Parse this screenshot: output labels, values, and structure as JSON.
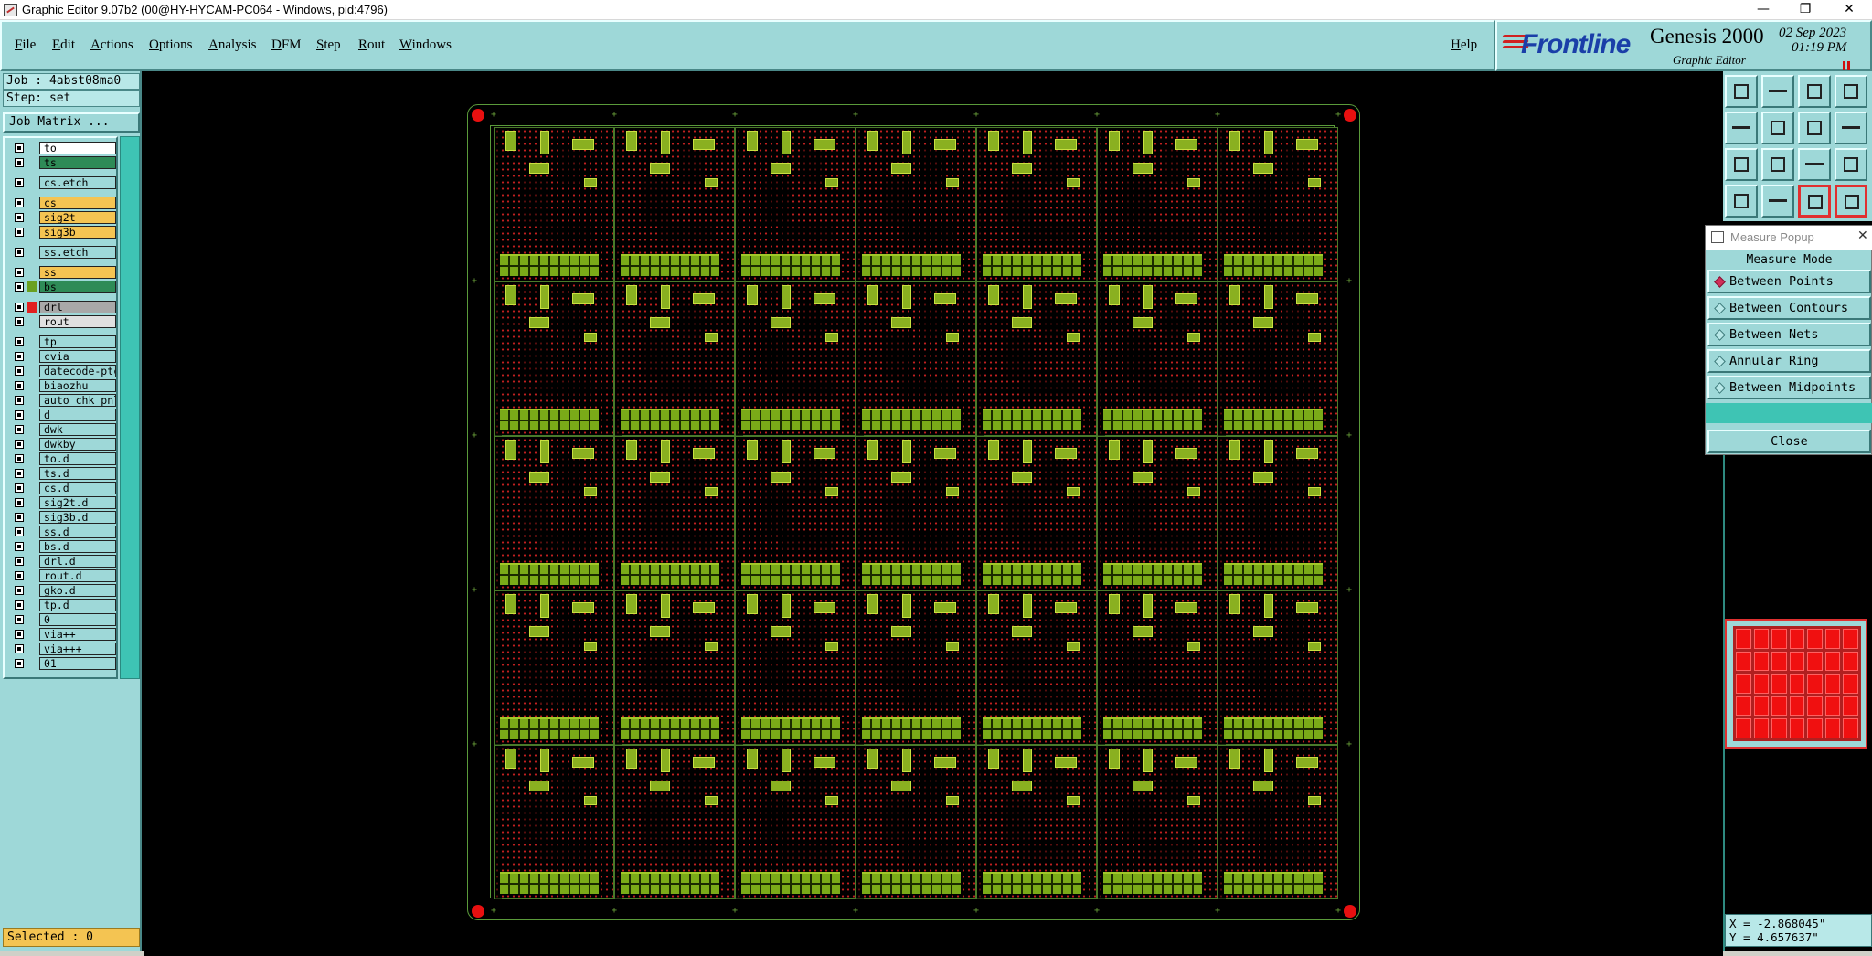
{
  "window": {
    "title": "Graphic Editor 9.07b2 (00@HY-HYCAM-PC064 - Windows, pid:4796)",
    "minimize": "—",
    "restore": "❐",
    "close": "✕"
  },
  "menubar": {
    "items": [
      "File",
      "Edit",
      "Actions",
      "Options",
      "Analysis",
      "DFM",
      "Step",
      "Rout",
      "Windows"
    ],
    "help": "Help"
  },
  "brand": {
    "logo": "Frontline",
    "product": "Genesis 2000",
    "subtitle": "Graphic Editor",
    "date": "02 Sep 2023",
    "time": "01:19 PM"
  },
  "job": {
    "job_label": "Job : 4abst08ma0",
    "step_label": "Step: set",
    "job_matrix_button": "Job Matrix ..."
  },
  "layers": [
    {
      "name": "to",
      "color": "#ffffff",
      "swatch": "",
      "gap": false
    },
    {
      "name": "ts",
      "color": "#2e8b57",
      "swatch": "",
      "gap": false
    },
    {
      "name": "cs.etch",
      "color": "#9ed8d8",
      "swatch": "",
      "gap": true
    },
    {
      "name": "cs",
      "color": "#f4c452",
      "swatch": "",
      "gap": true
    },
    {
      "name": "sig2t",
      "color": "#f4c452",
      "swatch": "",
      "gap": false
    },
    {
      "name": "sig3b",
      "color": "#f4c452",
      "swatch": "",
      "gap": false
    },
    {
      "name": "ss.etch",
      "color": "#9ed8d8",
      "swatch": "",
      "gap": true
    },
    {
      "name": "ss",
      "color": "#f4c452",
      "swatch": "",
      "gap": true
    },
    {
      "name": "bs",
      "color": "#2e8b57",
      "swatch": "#6aa020",
      "gap": false
    },
    {
      "name": "drl",
      "color": "#a8a8a8",
      "swatch": "#e02020",
      "gap": true
    },
    {
      "name": "rout",
      "color": "#e0e0e0",
      "swatch": "",
      "gap": false
    },
    {
      "name": "tp",
      "color": "#9ed8d8",
      "swatch": "",
      "gap": true
    },
    {
      "name": "cvia",
      "color": "#9ed8d8",
      "swatch": "",
      "gap": false
    },
    {
      "name": "datecode-ptc",
      "color": "#9ed8d8",
      "swatch": "",
      "gap": false
    },
    {
      "name": "biaozhu",
      "color": "#9ed8d8",
      "swatch": "",
      "gap": false
    },
    {
      "name": "auto_chk_pnl",
      "color": "#9ed8d8",
      "swatch": "",
      "gap": false
    },
    {
      "name": "d",
      "color": "#9ed8d8",
      "swatch": "",
      "gap": false
    },
    {
      "name": "dwk",
      "color": "#9ed8d8",
      "swatch": "",
      "gap": false
    },
    {
      "name": "dwkby",
      "color": "#9ed8d8",
      "swatch": "",
      "gap": false
    },
    {
      "name": "to.d",
      "color": "#9ed8d8",
      "swatch": "",
      "gap": false
    },
    {
      "name": "ts.d",
      "color": "#9ed8d8",
      "swatch": "",
      "gap": false
    },
    {
      "name": "cs.d",
      "color": "#9ed8d8",
      "swatch": "",
      "gap": false
    },
    {
      "name": "sig2t.d",
      "color": "#9ed8d8",
      "swatch": "",
      "gap": false
    },
    {
      "name": "sig3b.d",
      "color": "#9ed8d8",
      "swatch": "",
      "gap": false
    },
    {
      "name": "ss.d",
      "color": "#9ed8d8",
      "swatch": "",
      "gap": false
    },
    {
      "name": "bs.d",
      "color": "#9ed8d8",
      "swatch": "",
      "gap": false
    },
    {
      "name": "drl.d",
      "color": "#9ed8d8",
      "swatch": "",
      "gap": false
    },
    {
      "name": "rout.d",
      "color": "#9ed8d8",
      "swatch": "",
      "gap": false
    },
    {
      "name": "gko.d",
      "color": "#9ed8d8",
      "swatch": "",
      "gap": false
    },
    {
      "name": "tp.d",
      "color": "#9ed8d8",
      "swatch": "",
      "gap": false
    },
    {
      "name": "0",
      "color": "#9ed8d8",
      "swatch": "",
      "gap": false
    },
    {
      "name": "via++",
      "color": "#9ed8d8",
      "swatch": "",
      "gap": false
    },
    {
      "name": "via+++",
      "color": "#9ed8d8",
      "swatch": "",
      "gap": false
    },
    {
      "name": "01",
      "color": "#9ed8d8",
      "swatch": "",
      "gap": false
    }
  ],
  "status": {
    "selected": "Selected : 0"
  },
  "toolbar": {
    "icons": [
      "top-view-icon",
      "bottom-view-icon",
      "home-icon",
      "split-window-icon",
      "pan-left-icon",
      "pan-right-icon",
      "zoom-box-icon",
      "redraw-icon",
      "zoom-fit-icon",
      "zoom-center-icon",
      "scale-one-to-two-icon",
      "help-question-icon",
      "measure-icon",
      "snap-icon",
      "layer-red-icon",
      "layer-red-2-icon"
    ]
  },
  "measure_popup": {
    "title": "Measure Popup",
    "close_x": "✕",
    "mode_header": "Measure Mode",
    "options": [
      "Between Points",
      "Between Contours",
      "Between Nets",
      "Annular Ring",
      "Between Midpoints"
    ],
    "selected_option": "Between Points",
    "close_button": "Close"
  },
  "coordinates": {
    "x": "X = -2.868045\"",
    "y": "Y = 4.657637\""
  },
  "panel_grid": {
    "columns": 7,
    "rows": 5
  }
}
